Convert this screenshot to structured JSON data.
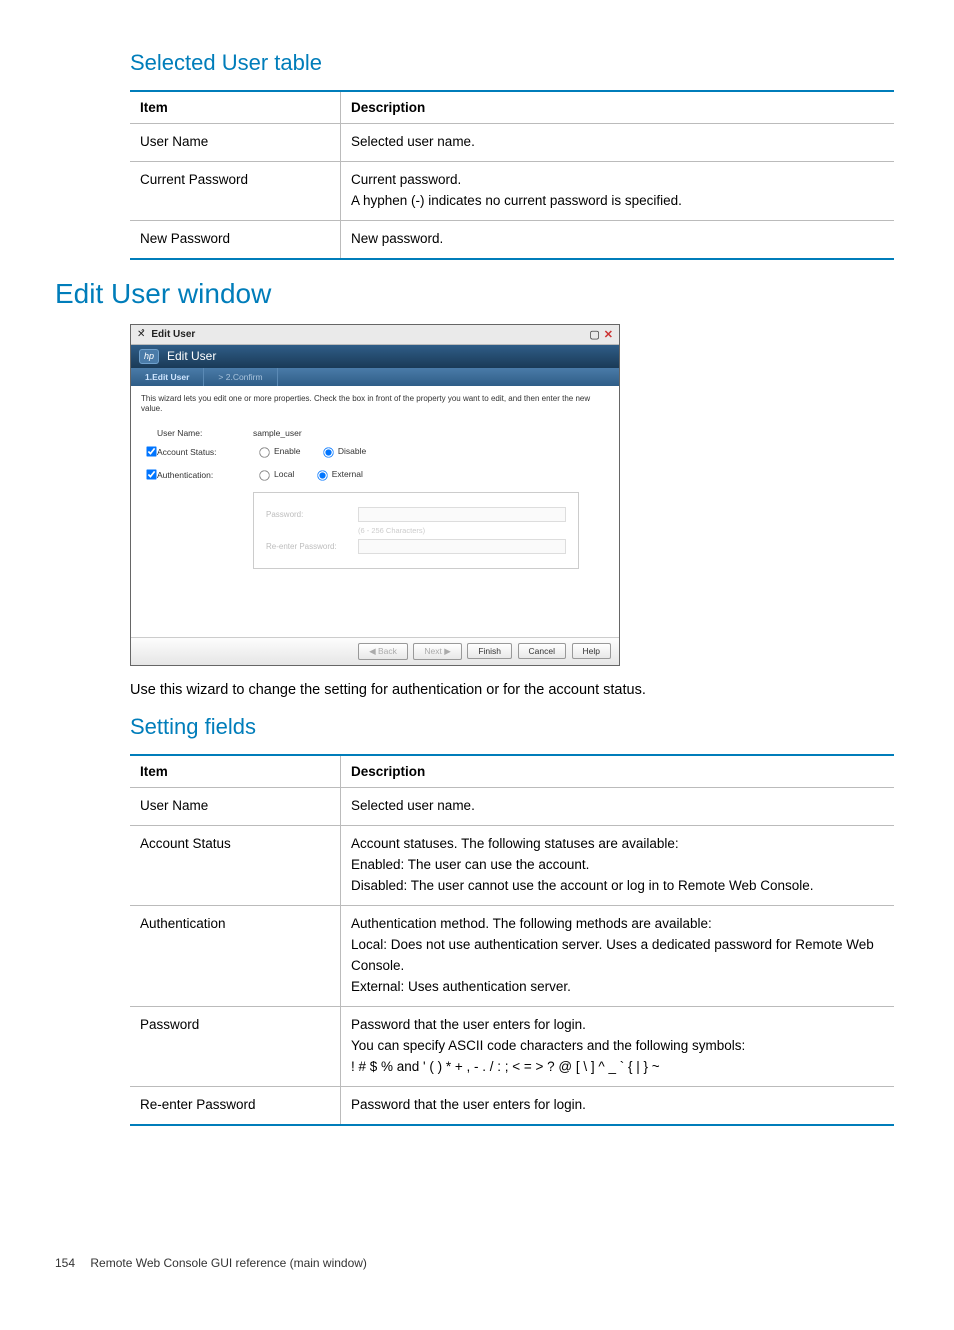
{
  "section1": {
    "heading": "Selected User table",
    "headers": {
      "item": "Item",
      "description": "Description"
    },
    "rows": [
      {
        "item": "User Name",
        "desc": "Selected user name."
      },
      {
        "item": "Current Password",
        "desc": "Current password.\nA hyphen (-) indicates no current password is specified."
      },
      {
        "item": "New Password",
        "desc": "New password."
      }
    ]
  },
  "major_heading": "Edit User window",
  "wizard": {
    "titlebar": "Edit User",
    "header": "Edit User",
    "step1": "1.Edit User",
    "step2": "> 2.Confirm",
    "desc": "This wizard lets you edit one or more properties. Check the  box in front of the property you want to edit, and then enter the new value.",
    "username_label": "User Name:",
    "username_value": "sample_user",
    "account_status_label": "Account Status:",
    "enable": "Enable",
    "disable": "Disable",
    "auth_label": "Authentication:",
    "local": "Local",
    "external": "External",
    "password_label": "Password:",
    "password_note": "(6 - 256 Characters)",
    "reenter_label": "Re-enter Password:",
    "buttons": {
      "back": "◀ Back",
      "next": "Next ▶",
      "finish": "Finish",
      "cancel": "Cancel",
      "help": "Help"
    }
  },
  "body_text": "Use this wizard to change the setting for authentication or for the account status.",
  "section2": {
    "heading": "Setting fields",
    "headers": {
      "item": "Item",
      "description": "Description"
    },
    "rows": [
      {
        "item": "User Name",
        "desc": "Selected user name."
      },
      {
        "item": "Account Status",
        "desc": "Account statuses. The following statuses are available:\nEnabled: The user can use the account.\nDisabled: The user cannot use the account or log in to Remote Web Console."
      },
      {
        "item": "Authentication",
        "desc": "Authentication method. The following methods are available:\nLocal: Does not use authentication server. Uses a dedicated password for Remote Web Console.\nExternal: Uses authentication server."
      },
      {
        "item": "Password",
        "desc": "Password that the user enters for login.\nYou can specify ASCII code characters and the following symbols:\n! # $ % and ' ( ) * + , - . / : ; < = > ? @ [ \\ ] ^ _ ` { | } ~"
      },
      {
        "item": "Re-enter Password",
        "desc": "Password that the user enters for login."
      }
    ]
  },
  "footer": {
    "page": "154",
    "text": "Remote Web Console GUI reference (main window)"
  }
}
